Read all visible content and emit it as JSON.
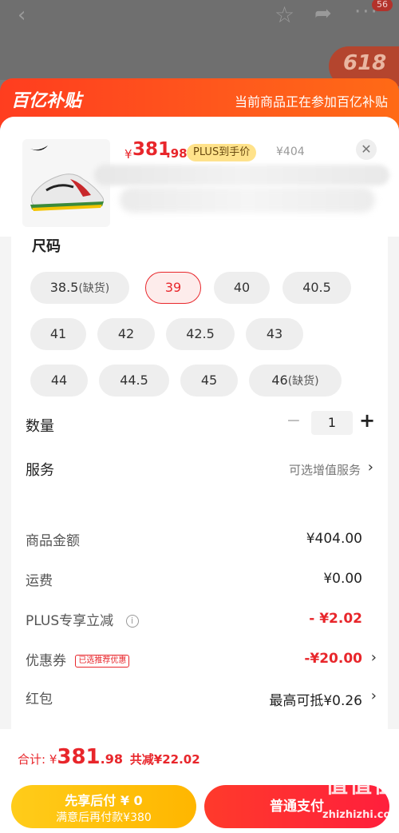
{
  "topbar": {
    "back_icon": "‹",
    "star_icon": "☆",
    "share_icon": "➦",
    "more_icon": "···",
    "badge_count": "56",
    "promo_text": "618"
  },
  "header": {
    "brand": "百亿补贴",
    "note": "当前商品正在参加百亿补贴"
  },
  "product": {
    "price_symbol": "¥",
    "price_int": "381",
    "price_dec": ".98",
    "plus_tag": "PLUS到手价",
    "orig_price": "¥404",
    "close_icon": "✕"
  },
  "size": {
    "title": "尺码",
    "options": [
      {
        "label": "38.5",
        "sub": "(缺货)"
      },
      {
        "label": "39",
        "sub": ""
      },
      {
        "label": "40",
        "sub": ""
      },
      {
        "label": "40.5",
        "sub": ""
      },
      {
        "label": "41",
        "sub": ""
      },
      {
        "label": "42",
        "sub": ""
      },
      {
        "label": "42.5",
        "sub": ""
      },
      {
        "label": "43",
        "sub": ""
      },
      {
        "label": "44",
        "sub": ""
      },
      {
        "label": "44.5",
        "sub": ""
      },
      {
        "label": "45",
        "sub": ""
      },
      {
        "label": "46",
        "sub": "(缺货)"
      }
    ],
    "selected": "39"
  },
  "quantity": {
    "label": "数量",
    "minus": "−",
    "value": "1",
    "plus": "+"
  },
  "service": {
    "label": "服务",
    "value": "可选增值服务",
    "chevron": "›"
  },
  "summary": {
    "goods_label": "商品金额",
    "goods_value": "¥404.00",
    "shipping_label": "运费",
    "shipping_value": "¥0.00",
    "plus_label": "PLUS专享立减",
    "plus_info_icon": "i",
    "plus_value": "- ¥2.02",
    "coupon_label": "优惠券",
    "coupon_tag": "已选推荐优惠",
    "coupon_value": "-¥20.00",
    "redpack_label": "红包",
    "redpack_value": "最高可抵¥0.26",
    "chevron": "›"
  },
  "bottom": {
    "total_label": "合计: ¥",
    "total_int": "381",
    "total_dec": ".98",
    "total_saved": "共减¥22.02",
    "left_btn_line1": "先享后付 ¥ 0",
    "left_btn_line2": "满意后再付款¥380",
    "right_btn": "普通支付"
  },
  "watermark": {
    "glyph": "值值值",
    "site": "zhizhizhi.com"
  }
}
